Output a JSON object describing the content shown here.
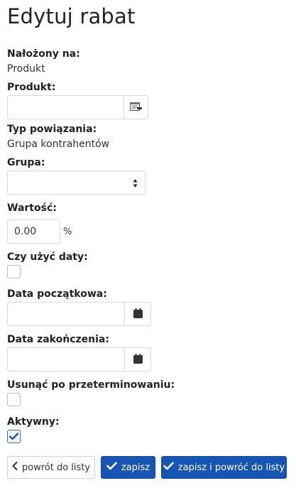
{
  "page": {
    "title": "Edytuj rabat"
  },
  "form": {
    "applied_to": {
      "label": "Nałożony na:",
      "value": "Produkt"
    },
    "product": {
      "label": "Produkt:",
      "value": ""
    },
    "relation_type": {
      "label": "Typ powiązania:",
      "value": "Grupa kontrahentów"
    },
    "group": {
      "label": "Grupa:",
      "selected": ""
    },
    "amount": {
      "label": "Wartość:",
      "value": "0.00",
      "unit": "%"
    },
    "use_dates": {
      "label": "Czy użyć daty:",
      "checked": false
    },
    "start_date": {
      "label": "Data początkowa:",
      "value": ""
    },
    "end_date": {
      "label": "Data zakończenia:",
      "value": ""
    },
    "remove_after_expiry": {
      "label": "Usunąć po przeterminowaniu:",
      "checked": false
    },
    "active": {
      "label": "Aktywny:",
      "checked": true
    }
  },
  "buttons": {
    "back": "powrót do listy",
    "save": "zapisz",
    "save_and_back": "zapisz i powróć do listy"
  },
  "colors": {
    "primary": "#1655b4",
    "border": "#d7d7d7"
  },
  "icons": {
    "product_picker": "list-select-icon",
    "calendar": "calendar-icon",
    "check": "check-icon",
    "back": "chevron-left-icon"
  }
}
